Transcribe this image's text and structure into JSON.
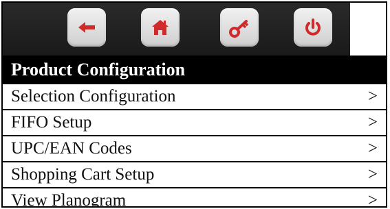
{
  "toolbar": {
    "buttons": [
      {
        "name": "back",
        "icon": "back-arrow-icon"
      },
      {
        "name": "home",
        "icon": "home-icon"
      },
      {
        "name": "key",
        "icon": "key-icon"
      },
      {
        "name": "power",
        "icon": "power-icon"
      }
    ],
    "icon_color": "#d12a2a"
  },
  "header": {
    "title": "Product Configuration"
  },
  "menu": {
    "items": [
      {
        "label": "Selection Configuration",
        "chevron": ">"
      },
      {
        "label": "FIFO Setup",
        "chevron": ">"
      },
      {
        "label": "UPC/EAN Codes",
        "chevron": ">"
      },
      {
        "label": "Shopping Cart Setup",
        "chevron": ">"
      },
      {
        "label": "View Planogram",
        "chevron": ">"
      }
    ]
  }
}
